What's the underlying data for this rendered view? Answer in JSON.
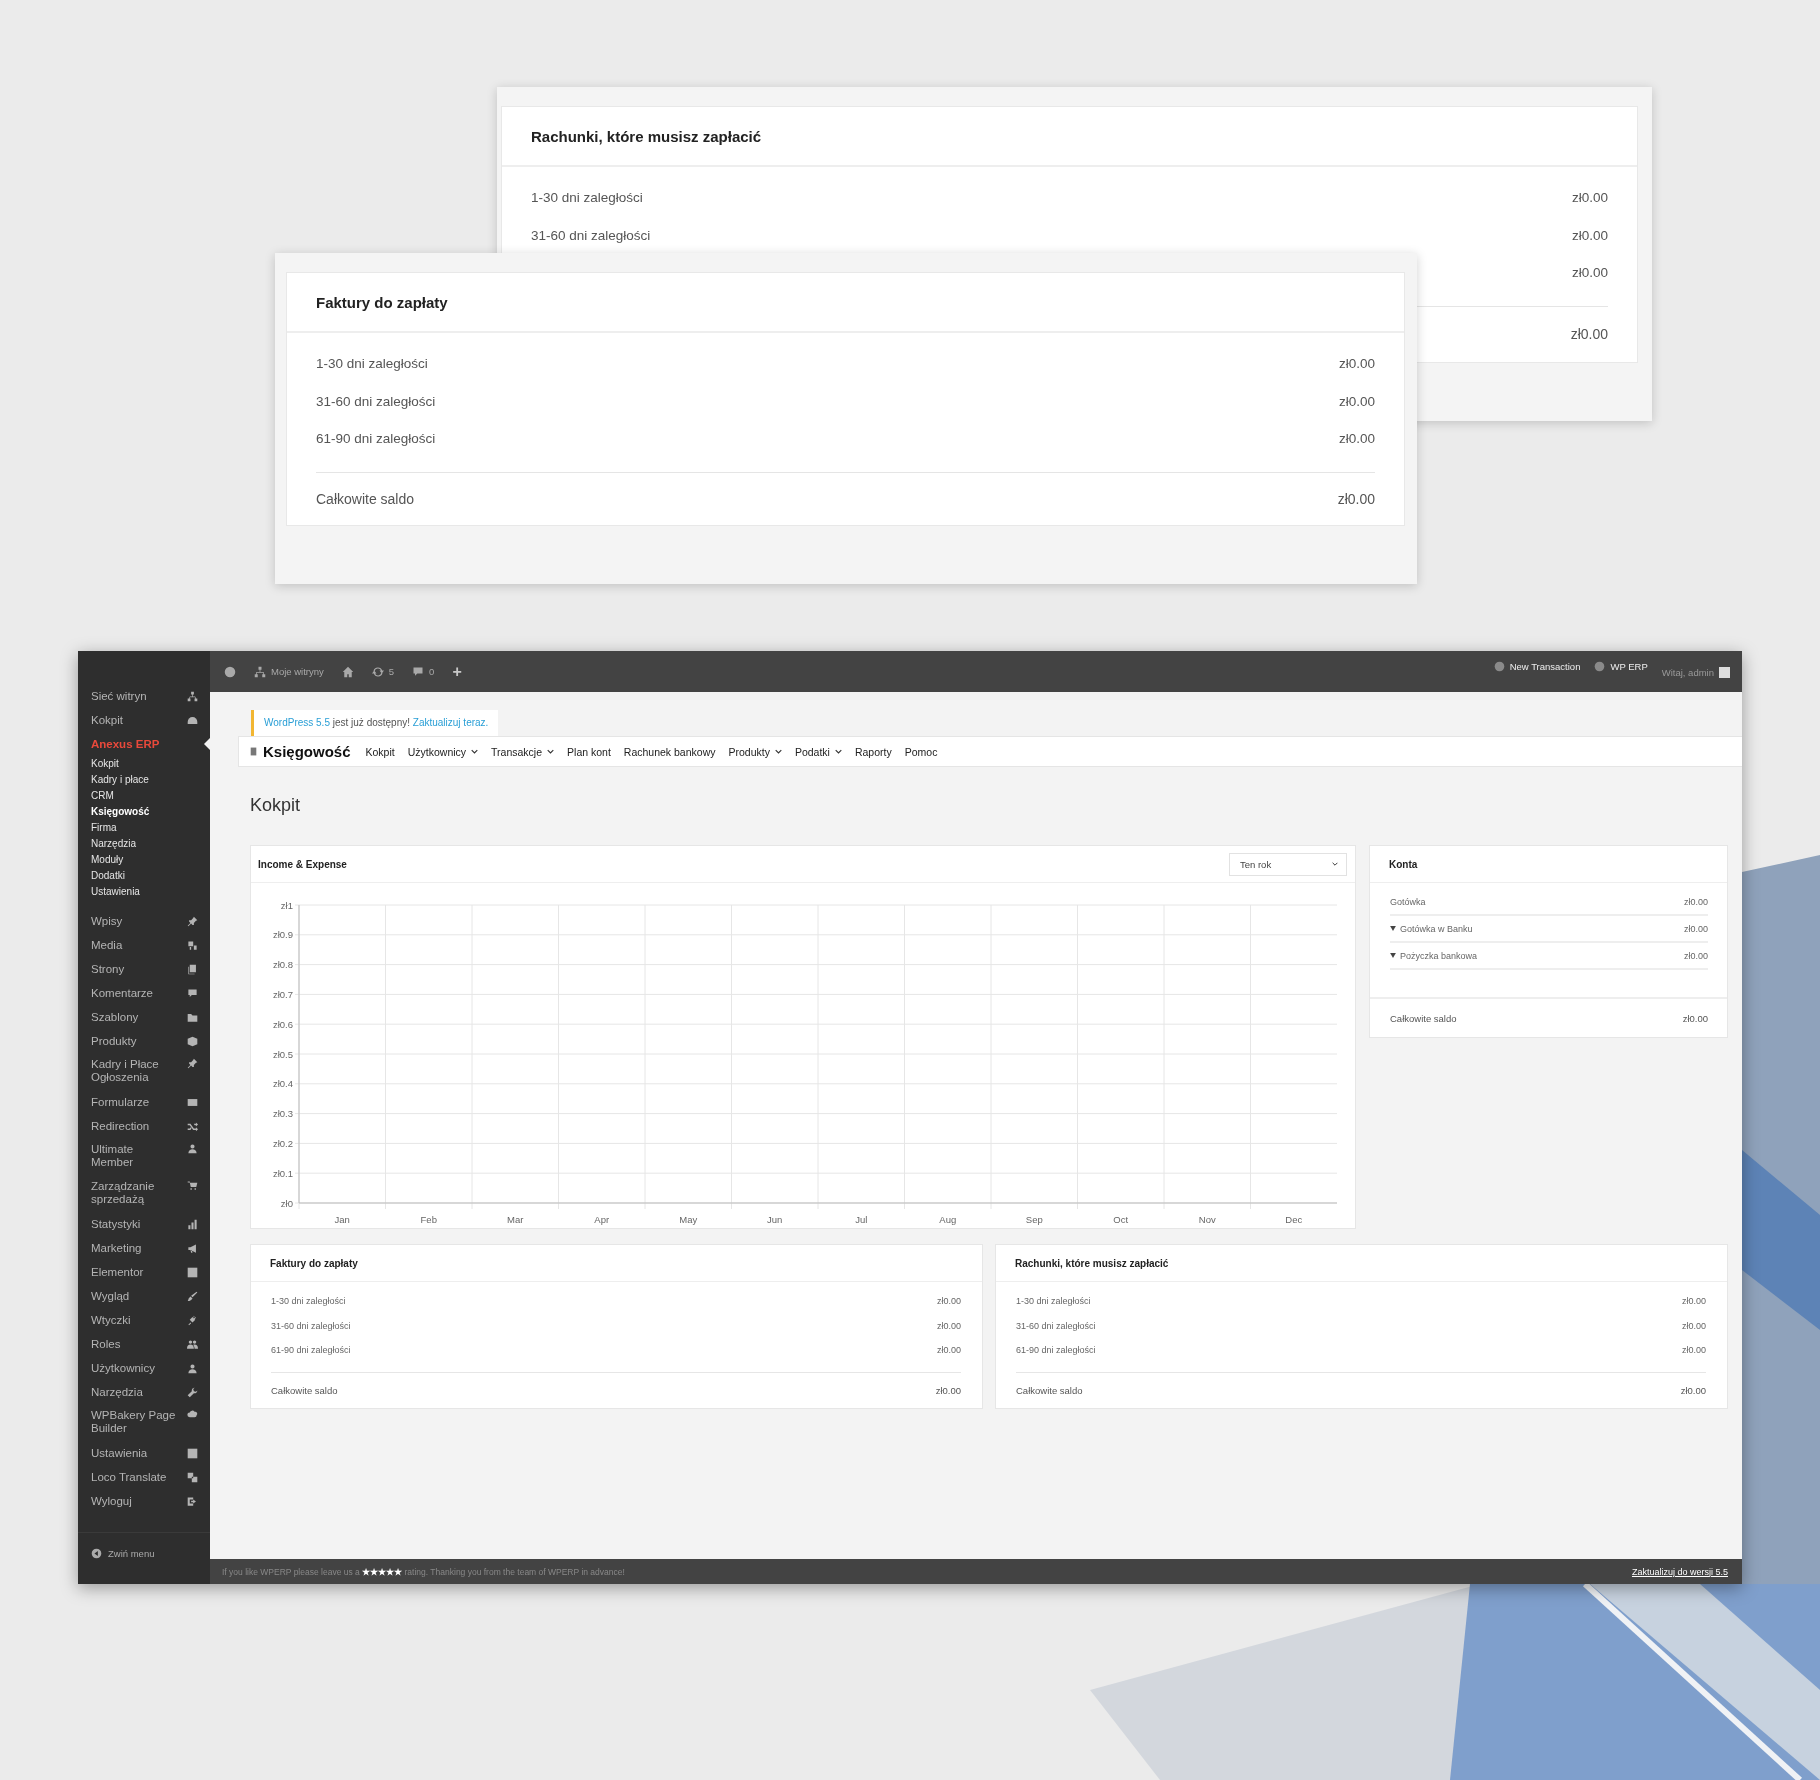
{
  "showcase_cards": [
    {
      "title": "Rachunki, które musisz zapłacić",
      "rows": [
        {
          "label": "1-30 dni zaległości",
          "value": "zł0.00"
        },
        {
          "label": "31-60 dni zaległości",
          "value": "zł0.00"
        },
        {
          "value": "zł0.00"
        }
      ],
      "total": {
        "value": "zł0.00"
      }
    },
    {
      "title": "Faktury do zapłaty",
      "rows": [
        {
          "label": "1-30 dni zaległości",
          "value": "zł0.00"
        },
        {
          "label": "31-60 dni zaległości",
          "value": "zł0.00"
        },
        {
          "label": "61-90 dni zaległości",
          "value": "zł0.00"
        }
      ],
      "total": {
        "label": "Całkowite saldo",
        "value": "zł0.00"
      }
    }
  ],
  "sidebar": {
    "items": [
      {
        "label": "Sieć witryn",
        "selected": false
      },
      {
        "label": "Kokpit",
        "selected": false
      },
      {
        "label": "Anexus ERP",
        "selected": true,
        "children": [
          {
            "label": "Kokpit",
            "selected": false
          },
          {
            "label": "Kadry i płace",
            "selected": false
          },
          {
            "label": "CRM",
            "selected": false
          },
          {
            "label": "Księgowość",
            "selected": true
          },
          {
            "label": "Firma",
            "selected": false
          },
          {
            "label": "Narzędzia",
            "selected": false
          },
          {
            "label": "Moduły",
            "selected": false
          },
          {
            "label": "Dodatki",
            "selected": false
          },
          {
            "label": "Ustawienia",
            "selected": false
          }
        ]
      },
      {
        "label": "Wpisy",
        "selected": false
      },
      {
        "label": "Media",
        "selected": false
      },
      {
        "label": "Strony",
        "selected": false
      },
      {
        "label": "Komentarze",
        "selected": false
      },
      {
        "label": "Szablony",
        "selected": false
      },
      {
        "label": "Produkty",
        "selected": false
      },
      {
        "label": "Kadry i Płace\nOgłoszenia",
        "selected": false
      },
      {
        "label": "Formularze",
        "selected": false
      },
      {
        "label": "Redirection",
        "selected": false
      },
      {
        "label": "Ultimate\nMember",
        "selected": false
      },
      {
        "label": "Zarządzanie\nsprzedażą",
        "selected": false
      },
      {
        "label": "Statystyki",
        "selected": false
      },
      {
        "label": "Marketing",
        "selected": false
      },
      {
        "label": "Elementor",
        "selected": false
      },
      {
        "label": "Wygląd",
        "selected": false
      },
      {
        "label": "Wtyczki",
        "selected": false
      },
      {
        "label": "Roles",
        "selected": false
      },
      {
        "label": "Użytkownicy",
        "selected": false
      },
      {
        "label": "Narzędzia",
        "selected": false
      },
      {
        "label": "WPBakery Page\nBuilder",
        "selected": false
      },
      {
        "label": "Ustawienia",
        "selected": false
      },
      {
        "label": "Loco Translate",
        "selected": false
      },
      {
        "label": "Wyloguj",
        "selected": false
      }
    ],
    "collapse": "Zwiń menu"
  },
  "admin_bar": {
    "items": [
      {
        "kind": "logo"
      },
      {
        "kind": "sites",
        "label": "Moje witryny"
      },
      {
        "kind": "home"
      },
      {
        "kind": "updates",
        "label": "5"
      },
      {
        "kind": "comments",
        "label": "0"
      },
      {
        "kind": "new",
        "label": "+"
      }
    ],
    "right": [
      {
        "label": "New Transaction"
      },
      {
        "label": "WP ERP"
      }
    ],
    "greeting": "Witaj, admin"
  },
  "notice": {
    "link": "WordPress 5.5",
    "text": "jest już dostępny!",
    "action": "Zaktualizuj teraz."
  },
  "erp_nav": {
    "title": "Księgowość",
    "items": [
      {
        "label": "Kokpit",
        "dropdown": false
      },
      {
        "label": "Użytkownicy",
        "dropdown": true
      },
      {
        "label": "Transakcje",
        "dropdown": true
      },
      {
        "label": "Plan kont",
        "dropdown": false
      },
      {
        "label": "Rachunek bankowy",
        "dropdown": false
      },
      {
        "label": "Produkty",
        "dropdown": true
      },
      {
        "label": "Podatki",
        "dropdown": true
      },
      {
        "label": "Raporty",
        "dropdown": false
      },
      {
        "label": "Pomoc",
        "dropdown": false
      }
    ]
  },
  "page_title": "Kokpit",
  "income_expense": {
    "title": "Income & Expense",
    "period": "Ten rok",
    "chart": {
      "x_labels": [
        "Jan",
        "Feb",
        "Mar",
        "Apr",
        "May",
        "Jun",
        "Jul",
        "Aug",
        "Sep",
        "Oct",
        "Nov",
        "Dec"
      ],
      "y_labels": [
        "zł1",
        "zł0.9",
        "zł0.8",
        "zł0.7",
        "zł0.6",
        "zł0.5",
        "zł0.4",
        "zł0.3",
        "zł0.2",
        "zł0.1",
        "zł0"
      ]
    }
  },
  "accounts": {
    "title": "Konta",
    "rows": [
      {
        "kind": "account",
        "label": "Gotówka",
        "value": "zł0.00"
      },
      {
        "kind": "group",
        "label": "Gotówka w Banku",
        "value": "zł0.00"
      },
      {
        "kind": "group",
        "label": "Pożyczka bankowa",
        "value": "zł0.00"
      }
    ],
    "total": {
      "label": "Całkowite saldo",
      "value": "zł0.00"
    }
  },
  "receivables": {
    "title": "Faktury do zapłaty",
    "rows": [
      {
        "label": "1-30 dni zaległości",
        "value": "zł0.00"
      },
      {
        "label": "31-60 dni zaległości",
        "value": "zł0.00"
      },
      {
        "label": "61-90 dni zaległości",
        "value": "zł0.00"
      }
    ],
    "total": {
      "label": "Całkowite saldo",
      "value": "zł0.00"
    }
  },
  "payables": {
    "title": "Rachunki, które musisz zapłacić",
    "rows": [
      {
        "label": "1-30 dni zaległości",
        "value": "zł0.00"
      },
      {
        "label": "31-60 dni zaległości",
        "value": "zł0.00"
      },
      {
        "label": "61-90 dni zaległości",
        "value": "zł0.00"
      }
    ],
    "total": {
      "label": "Całkowite saldo",
      "value": "zł0.00"
    }
  },
  "footer": {
    "text": "If you like WPERP please leave us a **★★★★★** rating. Thanking you from the team of WPERP in advance!",
    "link": "Zaktualizuj do wersji 5.5"
  }
}
